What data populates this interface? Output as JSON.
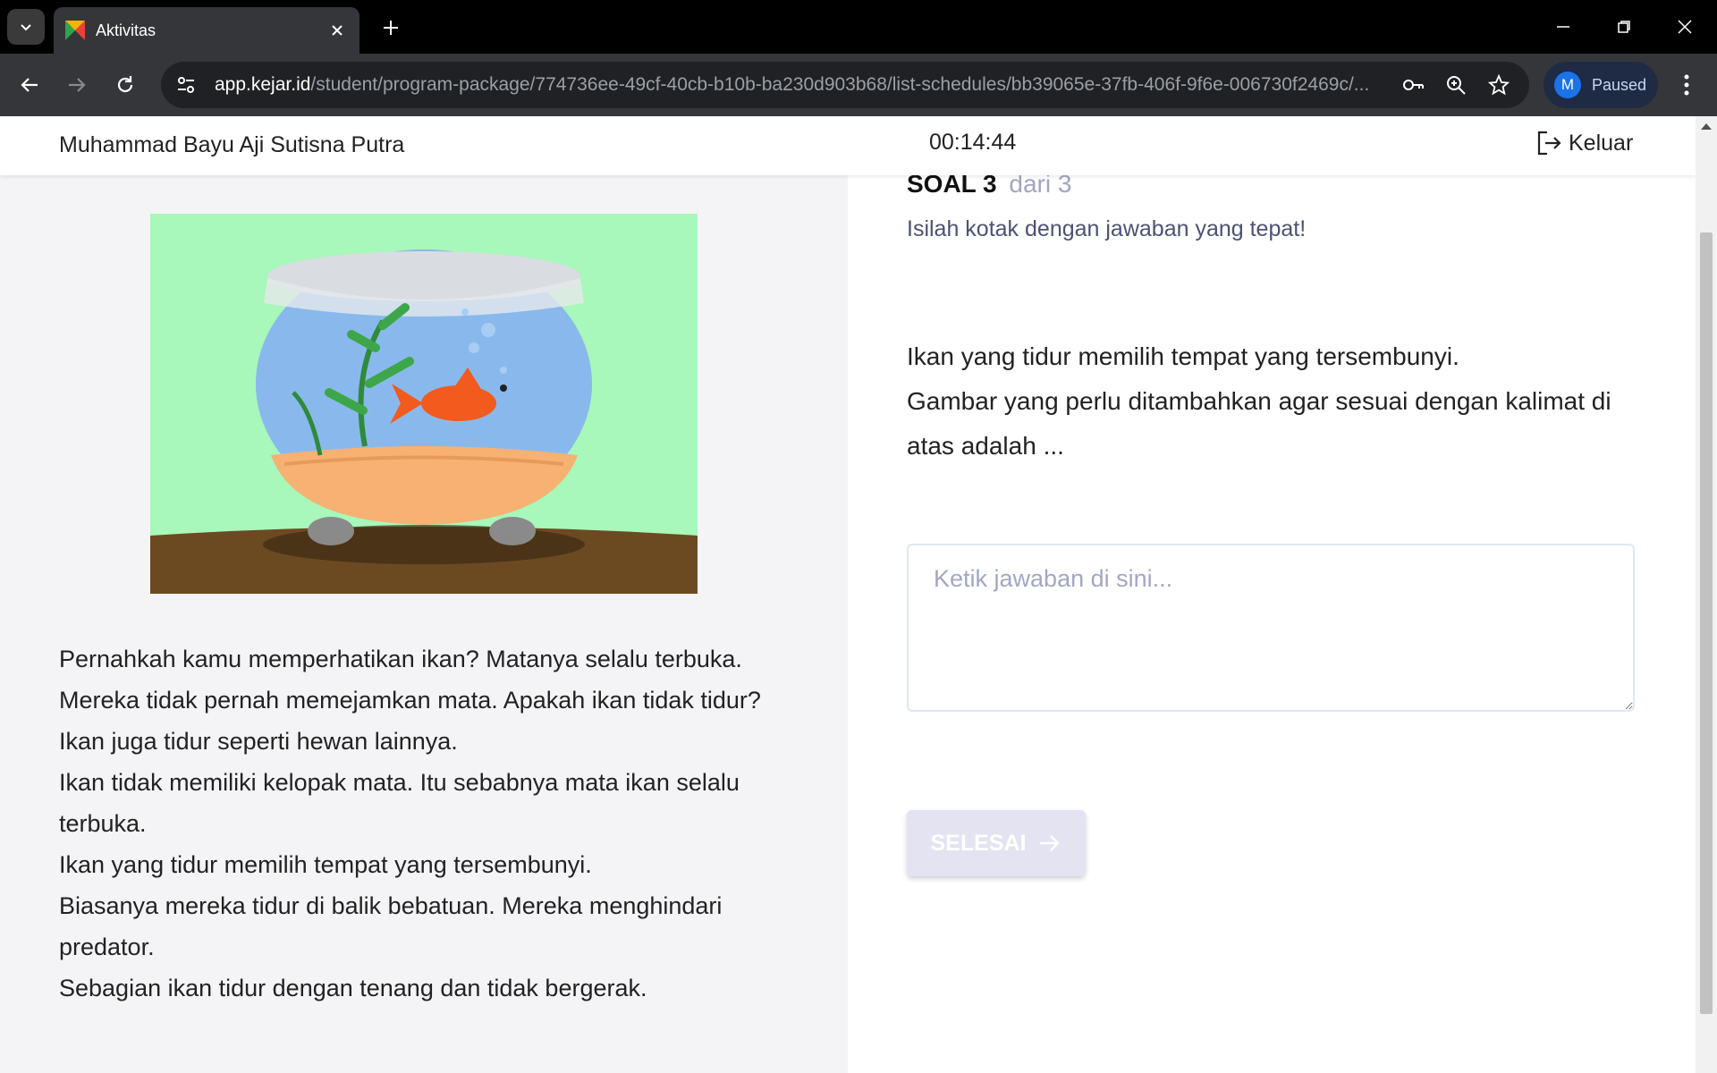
{
  "browser": {
    "tab_title": "Aktivitas",
    "url_host": "app.kejar.id",
    "url_path": "/student/program-package/774736ee-49cf-40cb-b10b-ba230d903b68/list-schedules/bb39065e-37fb-406f-9f6e-006730f2469c/...",
    "profile_initial": "M",
    "profile_status": "Paused"
  },
  "header": {
    "user_name": "Muhammad Bayu Aji Sutisna Putra",
    "timer": "00:14:44",
    "logout_label": "Keluar"
  },
  "story": {
    "paragraphs": [
      "Pernahkah kamu memperhatikan ikan? Matanya selalu terbuka.",
      "Mereka tidak pernah memejamkan mata. Apakah ikan tidak tidur?",
      "Ikan juga tidur seperti hewan lainnya.",
      "Ikan tidak memiliki kelopak mata. Itu sebabnya mata ikan selalu terbuka.",
      "Ikan yang tidur memilih tempat yang tersembunyi.",
      "Biasanya mereka tidur di balik bebatuan. Mereka menghindari predator.",
      "Sebagian ikan tidur dengan tenang dan tidak bergerak."
    ]
  },
  "question": {
    "label": "SOAL 3",
    "of_label": "dari 3",
    "instruction": "Isilah kotak dengan jawaban yang tepat!",
    "text_1": "Ikan yang tidur memilih tempat yang tersembunyi.",
    "text_2": "Gambar yang perlu ditambahkan agar sesuai dengan kalimat di atas adalah ...",
    "answer_placeholder": "Ketik jawaban di sini...",
    "answer_value": "",
    "submit_label": "SELESAI"
  },
  "colors": {
    "accent": "#1a73e8",
    "muted_label": "#a2a5c0",
    "button_disabled": "#e3e3f2",
    "illustration_bg": "#a8f7bb"
  }
}
